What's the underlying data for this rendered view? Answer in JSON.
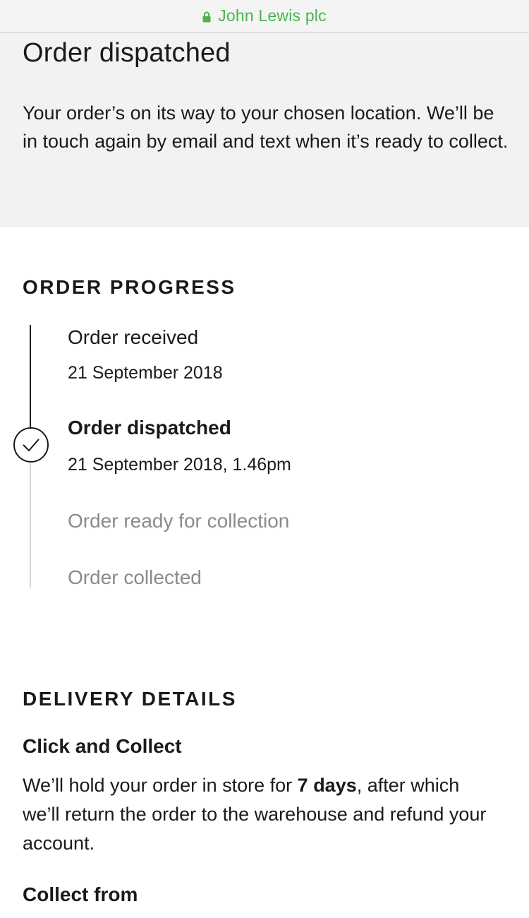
{
  "browser": {
    "site_name": "John Lewis plc",
    "lock_icon": "lock-icon",
    "accent_color": "#4bb24e"
  },
  "hero": {
    "title": "Order dispatched",
    "message": "Your order’s on its way to your chosen location. We’ll be in touch again by email and text when it’s ready to collect."
  },
  "order_progress": {
    "heading": "ORDER PROGRESS",
    "steps": [
      {
        "label": "Order received",
        "date": "21 September 2018",
        "state": "complete"
      },
      {
        "label": "Order dispatched",
        "date": "21 September 2018, 1.46pm",
        "state": "current"
      },
      {
        "label": "Order ready for collection",
        "state": "pending"
      },
      {
        "label": "Order collected",
        "state": "pending"
      }
    ],
    "current_icon": "checkmark-circle-icon"
  },
  "delivery_details": {
    "heading": "DELIVERY DETAILS",
    "method": "Click and Collect",
    "hold_text_before": "We’ll hold your order in store for ",
    "hold_days": "7 days",
    "hold_text_after": ", after which we’ll return the order to the warehouse and refund your account.",
    "collect_from_heading": "Collect from"
  }
}
